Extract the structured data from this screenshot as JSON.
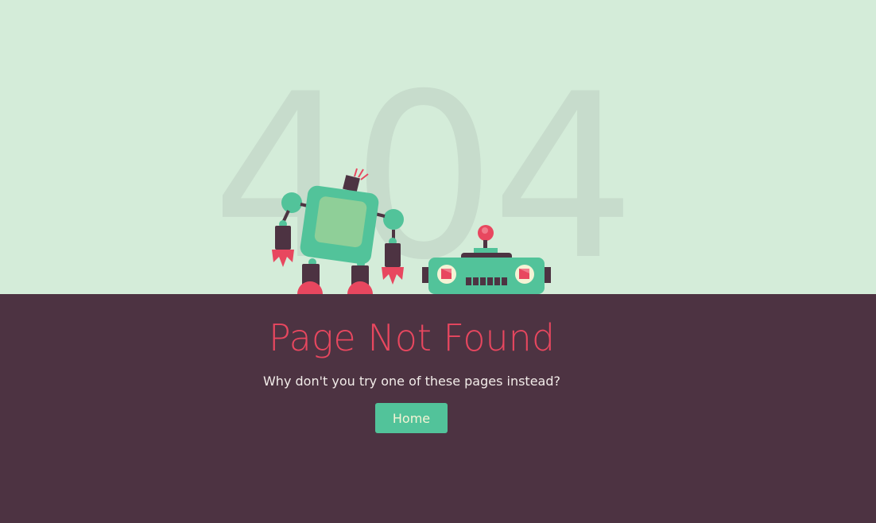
{
  "error_code": "404",
  "heading": "Page Not Found",
  "message": "Why don't you try one of these pages instead?",
  "home_button": "Home",
  "colors": {
    "top_background": "#d4ecd9",
    "bottom_background": "#4d3342",
    "accent_red": "#e8475f",
    "accent_green": "#52c39a"
  }
}
